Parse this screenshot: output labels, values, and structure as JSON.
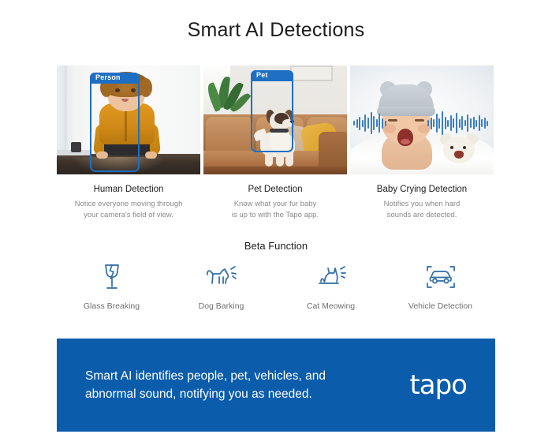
{
  "page": {
    "title": "Smart AI Detections"
  },
  "features": [
    {
      "id": "human-detection",
      "title": "Human Detection",
      "desc_line1": "Notice everyone moving through",
      "desc_line2": "your camera's field of view.",
      "detection_label": "Person",
      "image_alt": "Toddler in mustard sweater crawling on floor",
      "box_color": "#1e6fc4"
    },
    {
      "id": "pet-detection",
      "title": "Pet Detection",
      "desc_line1": "Know what your fur baby",
      "desc_line2": "is up to with the Tapo app.",
      "detection_label": "Pet",
      "image_alt": "Small white dog sitting on tan leather sofa",
      "box_color": "#1e6fc4"
    },
    {
      "id": "baby-crying-detection",
      "title": "Baby Crying Detection",
      "desc_line1": "Notifies you when hard",
      "desc_line2": "sounds are detected.",
      "detection_label": "",
      "image_alt": "Crying baby in grey knit bear hat beside teddy bear with sound waveform",
      "box_color": "#3c7fc2"
    }
  ],
  "beta": {
    "heading": "Beta Function",
    "items": [
      {
        "id": "glass-breaking",
        "label": "Glass Breaking",
        "icon": "broken-glass-icon"
      },
      {
        "id": "dog-barking",
        "label": "Dog Barking",
        "icon": "dog-barking-icon"
      },
      {
        "id": "cat-meowing",
        "label": "Cat Meowing",
        "icon": "cat-meowing-icon"
      },
      {
        "id": "vehicle-detection",
        "label": "Vehicle Detection",
        "icon": "vehicle-detection-icon"
      }
    ]
  },
  "banner": {
    "line1": "Smart AI identifies people, pet, vehicles, and",
    "line2": "abnormal sound, notifying you as needed.",
    "logo": "tapo",
    "background_color": "#0b5cab",
    "text_color": "#ffffff"
  },
  "colors": {
    "accent_blue": "#1e6fc4",
    "banner_blue": "#0b5cab",
    "waveform_blue": "#3c7fc2",
    "icon_blue": "#2e6da4",
    "title_text": "#1c1c1c",
    "body_text": "#8a8a8a"
  },
  "waveform": {
    "left_bars": [
      6,
      11,
      17,
      9,
      22,
      14,
      28,
      18,
      10,
      24,
      13,
      7
    ],
    "right_bars": [
      8,
      15,
      10,
      24,
      13,
      30,
      16,
      9,
      20,
      12,
      26,
      11,
      18,
      8,
      22,
      12,
      16,
      9,
      20,
      10,
      14,
      7
    ]
  }
}
